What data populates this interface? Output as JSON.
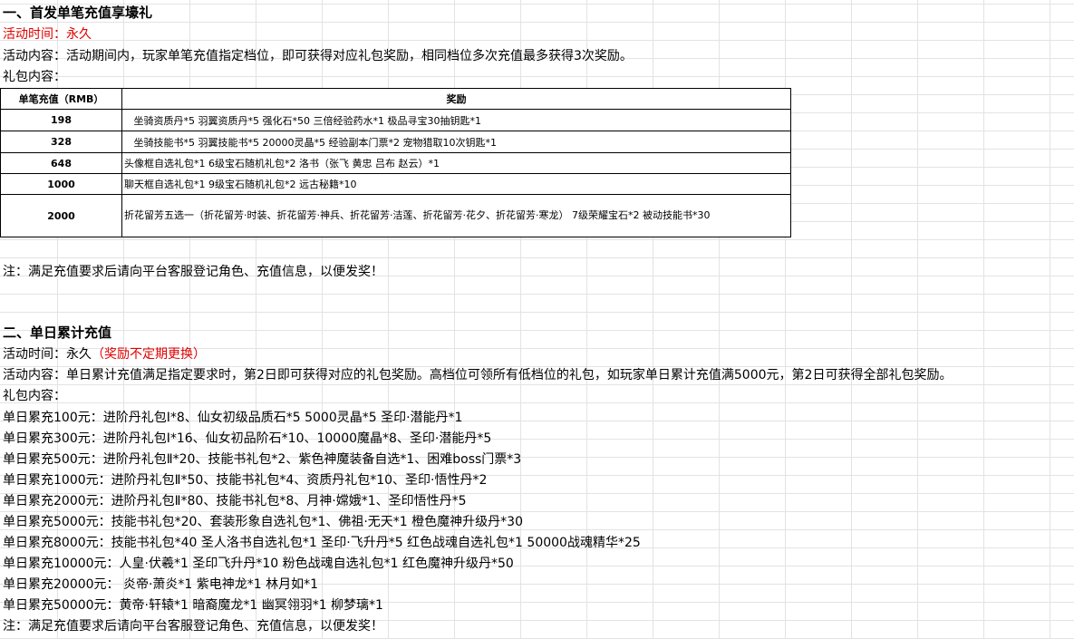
{
  "section1": {
    "title": "一、首发单笔充值享壕礼",
    "time": "活动时间：永久",
    "content": "活动内容：活动期间内，玩家单笔充值指定档位，即可获得对应礼包奖励，相同档位多次充值最多获得3次奖励。",
    "gift_label": "礼包内容：",
    "table": {
      "header_amount": "单笔充值（RMB）",
      "header_reward": "奖励",
      "rows": [
        {
          "amount": "198",
          "reward": "   坐骑资质丹*5 羽翼资质丹*5 强化石*50 三倍经验药水*1 极品寻宝30抽钥匙*1"
        },
        {
          "amount": "328",
          "reward": "   坐骑技能书*5 羽翼技能书*5 20000灵晶*5 经验副本门票*2 宠物猎取10次钥匙*1"
        },
        {
          "amount": "648",
          "reward": "头像框自选礼包*1 6级宝石随机礼包*2 洛书（张飞 黄忠 吕布 赵云）*1"
        },
        {
          "amount": "1000",
          "reward": "聊天框自选礼包*1 9级宝石随机礼包*2 远古秘籍*10"
        },
        {
          "amount": "2000",
          "reward": "折花留芳五选一（折花留芳·时装、折花留芳·神兵、折花留芳·洁莲、折花留芳·花夕、折花留芳·寒龙） 7级荣耀宝石*2 被动技能书*30"
        }
      ]
    },
    "note": "注：满足充值要求后请向平台客服登记角色、充值信息，以便发奖！"
  },
  "section2": {
    "title": "二、单日累计充值",
    "time_prefix": "活动时间：永久",
    "time_suffix": "（奖励不定期更换）",
    "content": "活动内容：单日累计充值满足指定要求时，第2日即可获得对应的礼包奖励。高档位可领所有低档位的礼包，如玩家单日累计充值满5000元，第2日可获得全部礼包奖励。",
    "gift_label": "礼包内容：",
    "items": [
      "单日累充100元：进阶丹礼包Ⅰ*8、仙女初级品质石*5 5000灵晶*5 圣印·潜能丹*1",
      "单日累充300元：进阶丹礼包Ⅰ*16、仙女初品阶石*10、10000魔晶*8、圣印·潜能丹*5",
      "单日累充500元：进阶丹礼包Ⅱ*20、技能书礼包*2、紫色神魔装备自选*1、困难boss门票*3",
      "单日累充1000元：进阶丹礼包Ⅱ*50、技能书礼包*4、资质丹礼包*10、圣印·悟性丹*2",
      "单日累充2000元：进阶丹礼包Ⅱ*80、技能书礼包*8、月神·嫦娥*1、圣印悟性丹*5",
      "单日累充5000元：技能书礼包*20、套装形象自选礼包*1、佛祖·无天*1 橙色魔神升级丹*30",
      "单日累充8000元：技能书礼包*40  圣人洛书自选礼包*1 圣印·飞升丹*5 红色战魂自选礼包*1 50000战魂精华*25",
      "单日累充10000元：人皇·伏羲*1 圣印飞升丹*10 粉色战魂自选礼包*1 红色魔神升级丹*50",
      "单日累充20000元：  炎帝·萧炎*1 紫电神龙*1 林月如*1",
      "单日累充50000元：黄帝·轩辕*1 暗裔魔龙*1 幽冥翎羽*1 柳梦璃*1"
    ],
    "note": "注：满足充值要求后请向平台客服登记角色、充值信息，以便发奖！"
  }
}
